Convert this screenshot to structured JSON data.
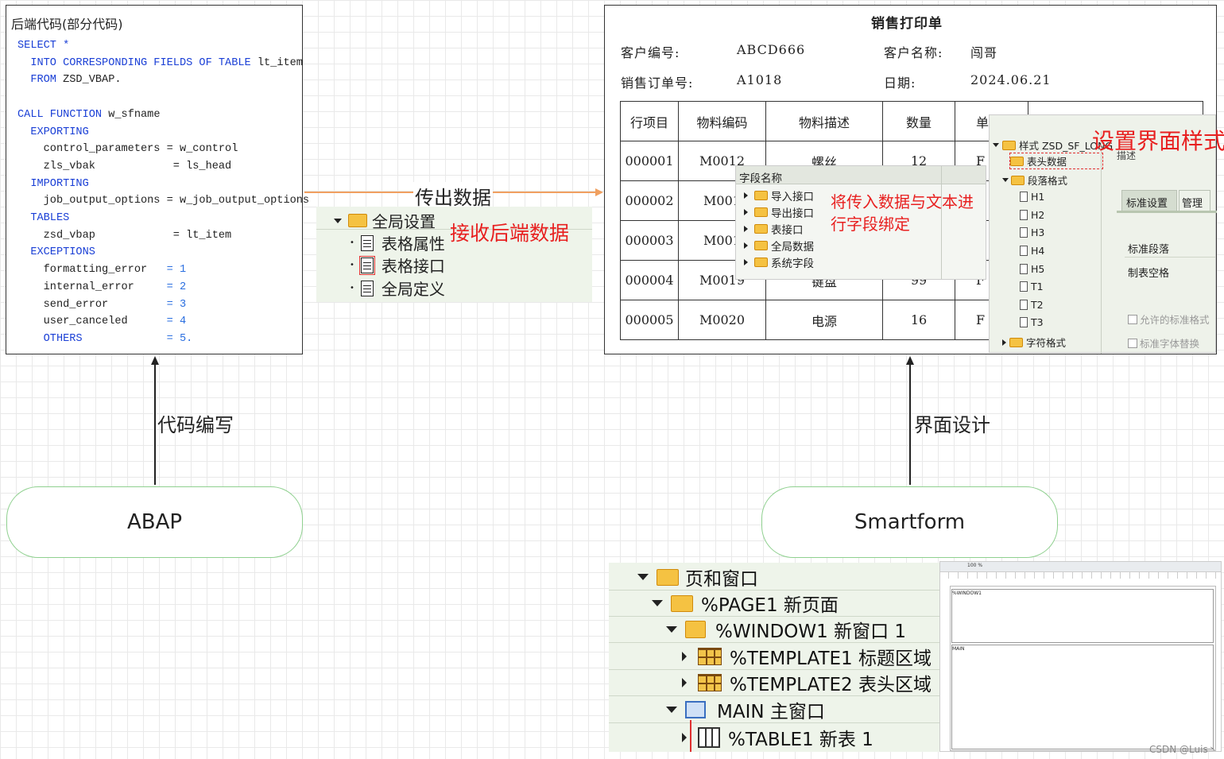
{
  "code_panel": {
    "title": "后端代码(部分代码)",
    "lines": [
      [
        [
          "kw",
          "SELECT *"
        ]
      ],
      [
        [
          "kw",
          "  INTO CORRESPONDING FIELDS OF TABLE"
        ],
        [
          "t",
          " lt_item"
        ]
      ],
      [
        [
          "kw",
          "  FROM"
        ],
        [
          "t",
          " ZSD_VBAP."
        ]
      ],
      [
        [
          "t",
          ""
        ]
      ],
      [
        [
          "kw",
          "CALL FUNCTION"
        ],
        [
          "t",
          " w_sfname"
        ]
      ],
      [
        [
          "kw",
          "  EXPORTING"
        ]
      ],
      [
        [
          "t",
          "    control_parameters = w_control"
        ]
      ],
      [
        [
          "t",
          "    zls_vbak            = ls_head"
        ]
      ],
      [
        [
          "kw",
          "  IMPORTING"
        ]
      ],
      [
        [
          "t",
          "    job_output_options = w_job_output_options"
        ]
      ],
      [
        [
          "kw",
          "  TABLES"
        ]
      ],
      [
        [
          "t",
          "    zsd_vbap            = lt_item"
        ]
      ],
      [
        [
          "kw",
          "  EXCEPTIONS"
        ]
      ],
      [
        [
          "t",
          "    formatting_error   "
        ],
        [
          "num",
          "= 1"
        ]
      ],
      [
        [
          "t",
          "    internal_error     "
        ],
        [
          "num",
          "= 2"
        ]
      ],
      [
        [
          "t",
          "    send_error         "
        ],
        [
          "num",
          "= 3"
        ]
      ],
      [
        [
          "t",
          "    user_canceled      "
        ],
        [
          "num",
          "= 4"
        ]
      ],
      [
        [
          "kw",
          "    OTHERS             "
        ],
        [
          "num",
          "= 5."
        ]
      ]
    ]
  },
  "labels": {
    "transfer": "传出数据",
    "code_writing": "代码编写",
    "ui_design": "界面设计",
    "receive_backend": "接收后端数据",
    "bind_fields": "将传入数据与文本进行字段绑定",
    "set_style": "设置界面样式",
    "watermark": "CSDN @Luis丶"
  },
  "nodes": {
    "abap": "ABAP",
    "smartform": "Smartform"
  },
  "global_tree": {
    "root": "全局设置",
    "items": [
      "表格属性",
      "表格接口",
      "全局定义"
    ]
  },
  "print_form": {
    "title": "销售打印单",
    "customer_no_label": "客户编号:",
    "customer_no": "ABCD666",
    "customer_name_label": "客户名称:",
    "customer_name": "闯哥",
    "order_no_label": "销售订单号:",
    "order_no": "A1018",
    "date_label": "日期:",
    "date": "2024.06.21",
    "headers": [
      "行项目",
      "物料编码",
      "物料描述",
      "数量",
      "单"
    ],
    "rows": [
      [
        "000001",
        "M0012",
        "螺丝",
        "12",
        "F"
      ],
      [
        "000002",
        "M001",
        "",
        "",
        "F"
      ],
      [
        "000003",
        "M001",
        "",
        "",
        "F"
      ],
      [
        "000004",
        "M0019",
        "键盘",
        "99",
        "F"
      ],
      [
        "000005",
        "M0020",
        "电源",
        "16",
        "F"
      ]
    ]
  },
  "field_panel": {
    "header": "字段名称",
    "items": [
      "导入接口",
      "导出接口",
      "表接口",
      "全局数据",
      "系统字段"
    ]
  },
  "style_panel": {
    "root": "样式 ZSD_SF_LONG",
    "header_data": "表头数据",
    "paragraph": "段落格式",
    "paras": [
      "H1",
      "H2",
      "H3",
      "H4",
      "H5",
      "T1",
      "T2",
      "T3"
    ],
    "char_format": "字符格式",
    "tab_standard": "标准设置",
    "tab_manage": "管理",
    "side_label": "描述",
    "opt1": "标准段落",
    "opt2": "制表空格",
    "chk1": "允许的标准格式",
    "chk2": "标准字体替换"
  },
  "page_tree": {
    "root": "页和窗口",
    "page": "%PAGE1 新页面",
    "window": "%WINDOW1 新窗口 1",
    "tpl1": "%TEMPLATE1 标题区域",
    "tpl2": "%TEMPLATE2 表头区域",
    "main": "MAIN 主窗口",
    "table": "%TABLE1 新表 1"
  },
  "preview": {
    "window_label": "%WINDOW1",
    "main_label": "MAIN",
    "zoom": "100 %"
  }
}
